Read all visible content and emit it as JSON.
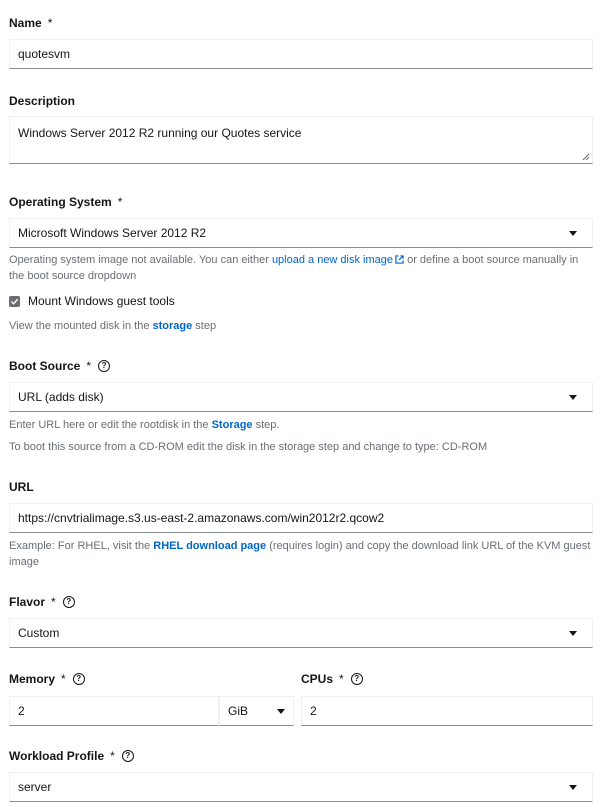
{
  "name": {
    "label": "Name",
    "required": "*",
    "value": "quotesvm"
  },
  "description": {
    "label": "Description",
    "value": "Windows Server 2012 R2 running our Quotes service"
  },
  "os": {
    "label": "Operating System",
    "required": "*",
    "value": "Microsoft Windows Server 2012 R2",
    "helper_1": "Operating system image not available. You can either ",
    "helper_link": "upload a new disk image",
    "helper_2": " or define a boot source manually in the boot source dropdown",
    "checkbox_label": "Mount Windows guest tools",
    "checkbox_checked": true,
    "mounted_1": "View the mounted disk in the ",
    "mounted_link": "storage",
    "mounted_2": " step"
  },
  "boot_source": {
    "label": "Boot Source",
    "required": "*",
    "value": "URL (adds disk)",
    "helper_1": "Enter URL here or edit the rootdisk in the ",
    "helper_link": "Storage",
    "helper_2": " step.",
    "helper_cdrom": "To boot this source from a CD-ROM edit the disk in the storage step and change to type: CD-ROM"
  },
  "url": {
    "label": "URL",
    "value": "https://cnvtrialimage.s3.us-east-2.amazonaws.com/win2012r2.qcow2",
    "helper_1": "Example: For RHEL, visit the ",
    "helper_link": "RHEL download page",
    "helper_2": " (requires login) and copy the download link URL of the KVM guest image"
  },
  "flavor": {
    "label": "Flavor",
    "required": "*",
    "value": "Custom"
  },
  "memory": {
    "label": "Memory",
    "required": "*",
    "value": "2",
    "unit": "GiB"
  },
  "cpus": {
    "label": "CPUs",
    "required": "*",
    "value": "2"
  },
  "workload_profile": {
    "label": "Workload Profile",
    "required": "*",
    "value": "server"
  },
  "icons": {
    "help": "question-circle-icon",
    "dropdown": "caret-down-icon",
    "external": "external-link-icon"
  },
  "colors": {
    "link": "#0066cc",
    "helper_text": "#6a6e73",
    "border_bottom": "#8a8d90"
  }
}
